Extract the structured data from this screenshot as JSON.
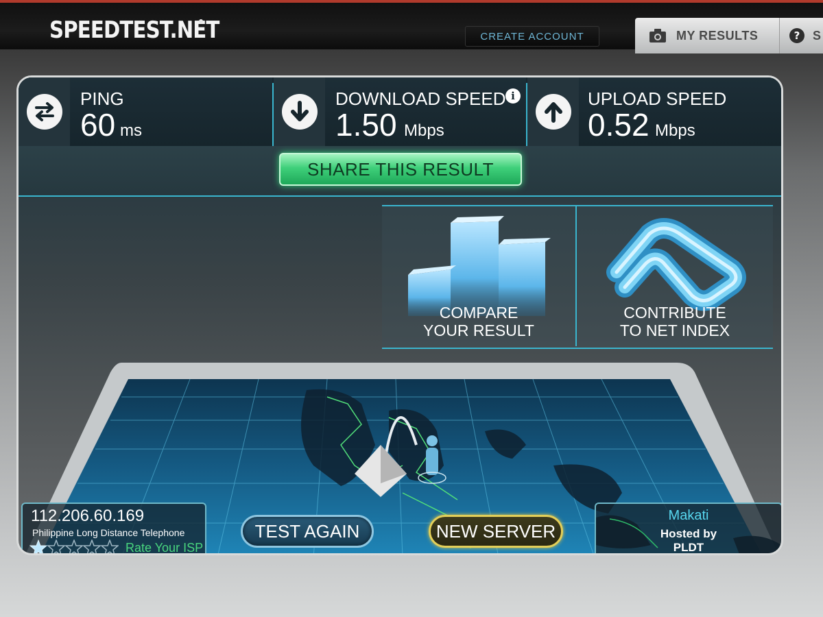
{
  "header": {
    "logo": "SPEEDTEST.NET",
    "create_account": "CREATE ACCOUNT",
    "my_results": "MY RESULTS",
    "help_partial": "S",
    "icons": [
      "camera-icon",
      "help-icon"
    ]
  },
  "metrics": {
    "ping": {
      "title": "PING",
      "value": "60",
      "unit": "ms"
    },
    "download": {
      "title": "DOWNLOAD SPEED",
      "value": "1.50",
      "unit": "Mbps"
    },
    "upload": {
      "title": "UPLOAD SPEED",
      "value": "0.52",
      "unit": "Mbps"
    }
  },
  "share": {
    "label": "SHARE THIS RESULT"
  },
  "tiles": {
    "compare": {
      "line1": "COMPARE",
      "line2": "YOUR RESULT"
    },
    "contribute": {
      "line1": "CONTRIBUTE",
      "line2": "TO NET INDEX"
    }
  },
  "client": {
    "ip": "112.206.60.169",
    "isp": "Philippine Long Distance Telephone",
    "rating": 1,
    "rating_max": 5,
    "rate_label": "Rate Your ISP"
  },
  "actions": {
    "test_again": "TEST AGAIN",
    "new_server": "NEW SERVER"
  },
  "server": {
    "city": "Makati",
    "hosted_by_line1": "Hosted by",
    "hosted_by_line2": "PLDT"
  },
  "colors": {
    "accent_cyan": "#3ab6cf",
    "share_green": "#3fd07a",
    "new_server_gold": "#e3cf59",
    "rate_green": "#49d67e",
    "city_cyan": "#58d7ef"
  }
}
